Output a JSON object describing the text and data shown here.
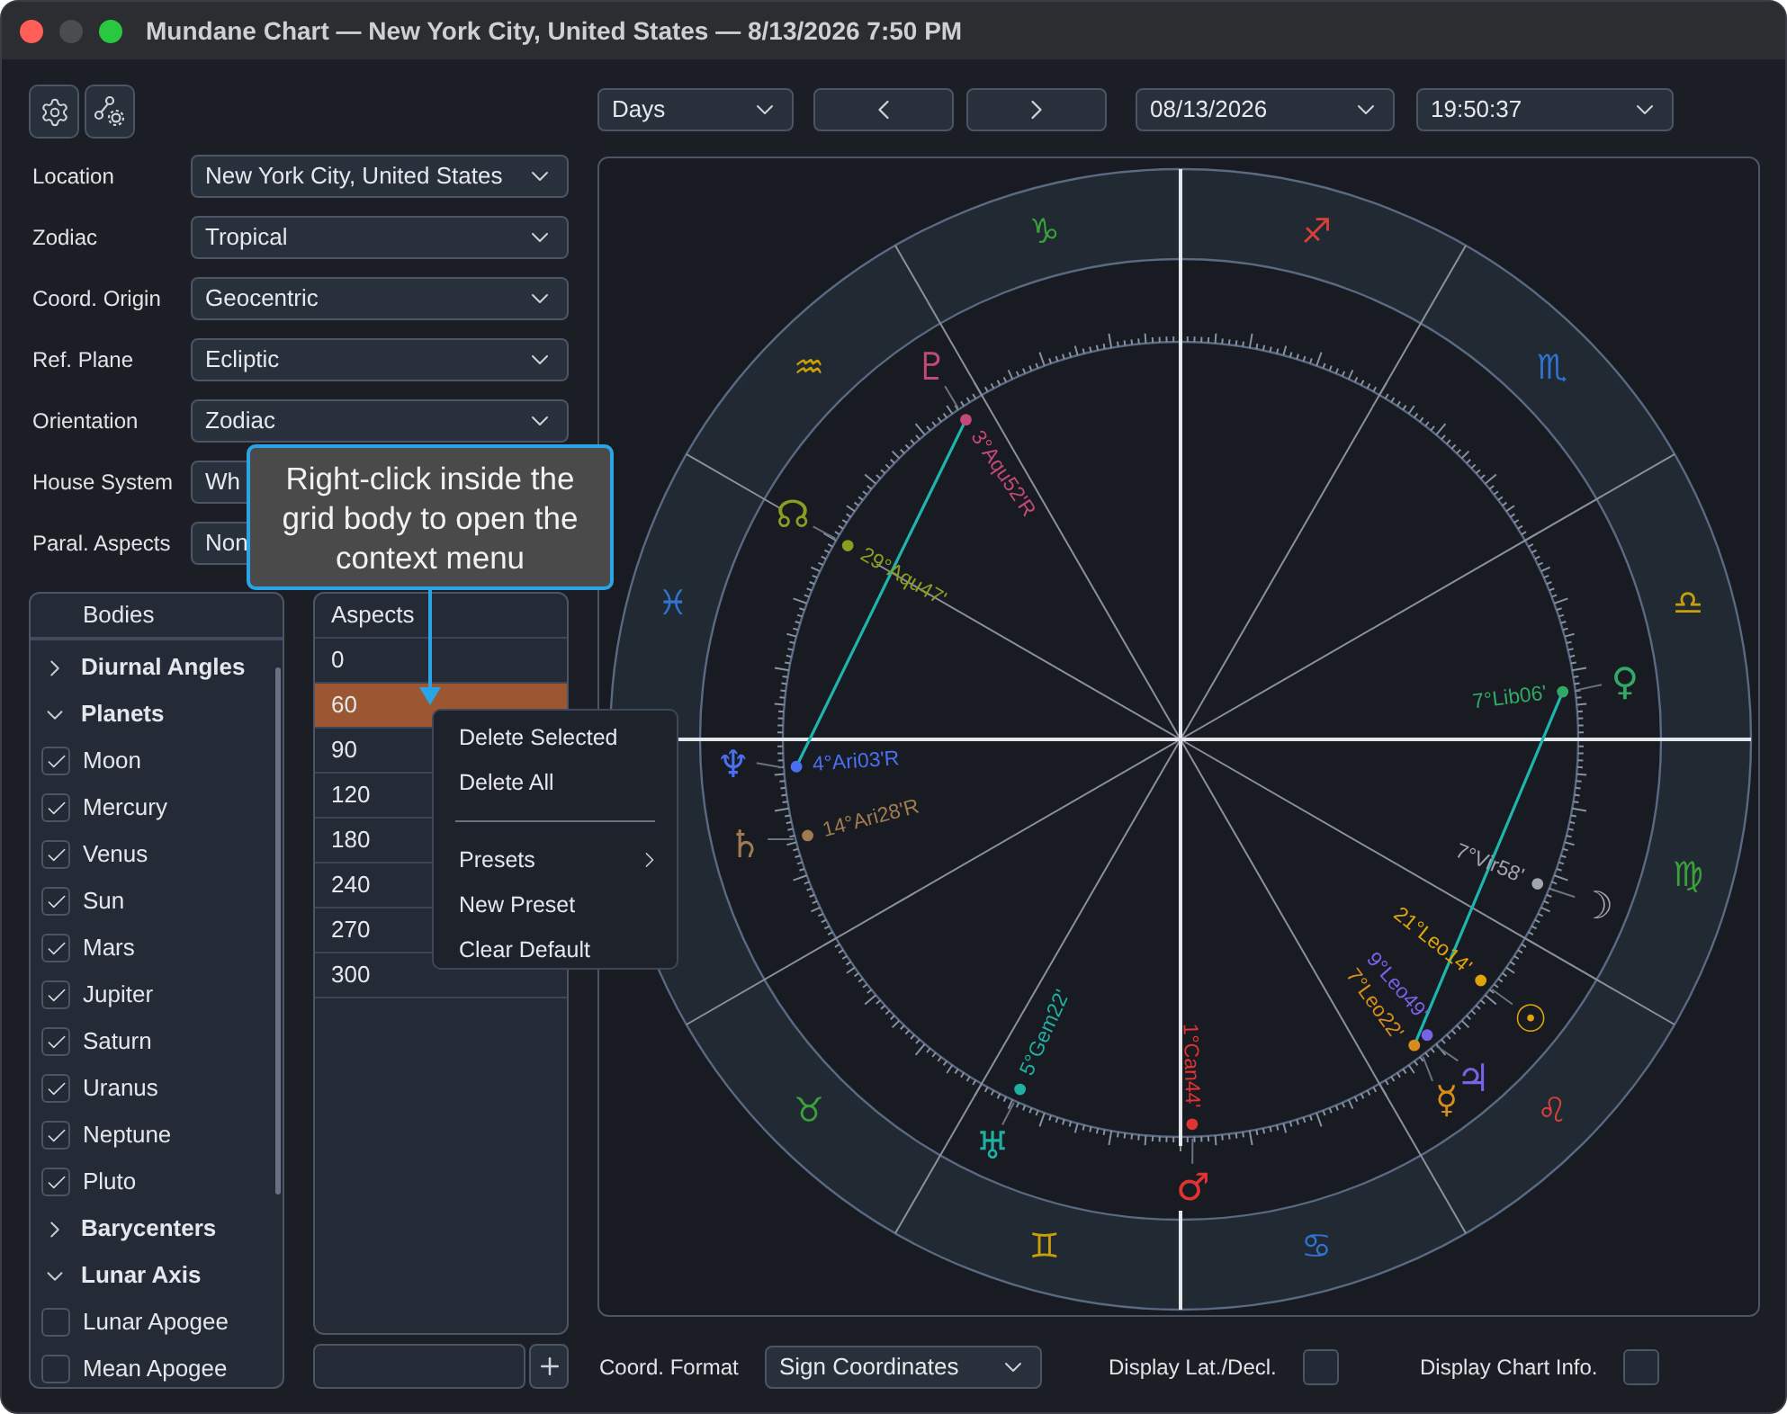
{
  "window": {
    "title": "Mundane Chart — New York City, United States — 8/13/2026 7:50 PM"
  },
  "settings": [
    {
      "label": "Location",
      "value": "New York City, United States"
    },
    {
      "label": "Zodiac",
      "value": "Tropical"
    },
    {
      "label": "Coord. Origin",
      "value": "Geocentric"
    },
    {
      "label": "Ref. Plane",
      "value": "Ecliptic"
    },
    {
      "label": "Orientation",
      "value": "Zodiac"
    },
    {
      "label": "House System",
      "value": "Wh"
    },
    {
      "label": "Paral. Aspects",
      "value": "Non"
    }
  ],
  "tooltip": {
    "text": "Right-click inside the grid body to open the context menu"
  },
  "bodies": {
    "title": "Bodies",
    "items": [
      {
        "label": "Diurnal Angles",
        "expanded": false
      },
      {
        "label": "Planets",
        "expanded": true,
        "children": [
          {
            "label": "Moon",
            "checked": true
          },
          {
            "label": "Mercury",
            "checked": true
          },
          {
            "label": "Venus",
            "checked": true
          },
          {
            "label": "Sun",
            "checked": true
          },
          {
            "label": "Mars",
            "checked": true
          },
          {
            "label": "Jupiter",
            "checked": true
          },
          {
            "label": "Saturn",
            "checked": true
          },
          {
            "label": "Uranus",
            "checked": true
          },
          {
            "label": "Neptune",
            "checked": true
          },
          {
            "label": "Pluto",
            "checked": true
          }
        ]
      },
      {
        "label": "Barycenters",
        "expanded": false
      },
      {
        "label": "Lunar Axis",
        "expanded": true,
        "children": [
          {
            "label": "Lunar Apogee",
            "checked": false
          },
          {
            "label": "Mean Apogee",
            "checked": false
          }
        ]
      }
    ]
  },
  "aspects": {
    "title": "Aspects",
    "rows": [
      {
        "value": "0",
        "selected": false
      },
      {
        "value": "60",
        "selected": true
      },
      {
        "value": "90",
        "selected": false
      },
      {
        "value": "120",
        "selected": false
      },
      {
        "value": "180",
        "selected": false
      },
      {
        "value": "240",
        "selected": false
      },
      {
        "value": "270",
        "selected": false
      },
      {
        "value": "300",
        "selected": false
      }
    ]
  },
  "context_menu": {
    "items": [
      {
        "kind": "item",
        "label": "Delete Selected"
      },
      {
        "kind": "item",
        "label": "Delete All"
      },
      {
        "kind": "separator"
      },
      {
        "kind": "submenu",
        "label": "Presets"
      },
      {
        "kind": "item",
        "label": "New Preset"
      },
      {
        "kind": "item",
        "label": "Clear Default"
      }
    ]
  },
  "navigation": {
    "interval": "Days",
    "date": "08/13/2026",
    "time": "19:50:37"
  },
  "chart": {
    "signs": [
      {
        "glyph": "♉",
        "color": "#3aa03a"
      },
      {
        "glyph": "♊",
        "color": "#c9a008"
      },
      {
        "glyph": "♋",
        "color": "#2f74d0"
      },
      {
        "glyph": "♌",
        "color": "#d8403a"
      },
      {
        "glyph": "♍",
        "color": "#3aa03a"
      },
      {
        "glyph": "♎",
        "color": "#c9a008"
      },
      {
        "glyph": "♏",
        "color": "#2f74d0"
      },
      {
        "glyph": "♐",
        "color": "#d8403a"
      },
      {
        "glyph": "♑",
        "color": "#3aa03a"
      },
      {
        "glyph": "♒",
        "color": "#c9a008"
      },
      {
        "glyph": "♓",
        "color": "#2f74d0"
      }
    ],
    "bodies": [
      {
        "glyph": "♇",
        "position": "3°Aqu52'R",
        "color": "#c24a78"
      },
      {
        "glyph": "☊",
        "position": "29°Aqu47'",
        "color": "#8a9e22"
      },
      {
        "glyph": "♆",
        "position": "4°Ari03'R",
        "color": "#4a70f0"
      },
      {
        "glyph": "♄",
        "position": "14°Ari28'R",
        "color": "#a07a52"
      },
      {
        "glyph": "♅",
        "position": "5°Gem22'",
        "color": "#1fb0a2"
      },
      {
        "glyph": "♂",
        "position": "1°Can44'",
        "color": "#e03434"
      },
      {
        "glyph": "☿",
        "position": "7°Leo22'",
        "color": "#d88c1c"
      },
      {
        "glyph": "♃",
        "position": "9°Leo49'",
        "color": "#7a62e6"
      },
      {
        "glyph": "☉",
        "position": "21°Leo14'",
        "color": "#e0a408"
      },
      {
        "glyph": "☽",
        "position": "7°Vir58'",
        "color": "#a2a6ad"
      },
      {
        "glyph": "♀",
        "position": "7°Lib06'",
        "color": "#34a866"
      }
    ]
  },
  "bottom": {
    "coord_format_label": "Coord. Format",
    "coord_format": "Sign Coordinates",
    "lat_decl": {
      "label": "Display Lat./Decl.",
      "checked": false
    },
    "chart_info": {
      "label": "Display Chart Info.",
      "checked": false
    }
  }
}
